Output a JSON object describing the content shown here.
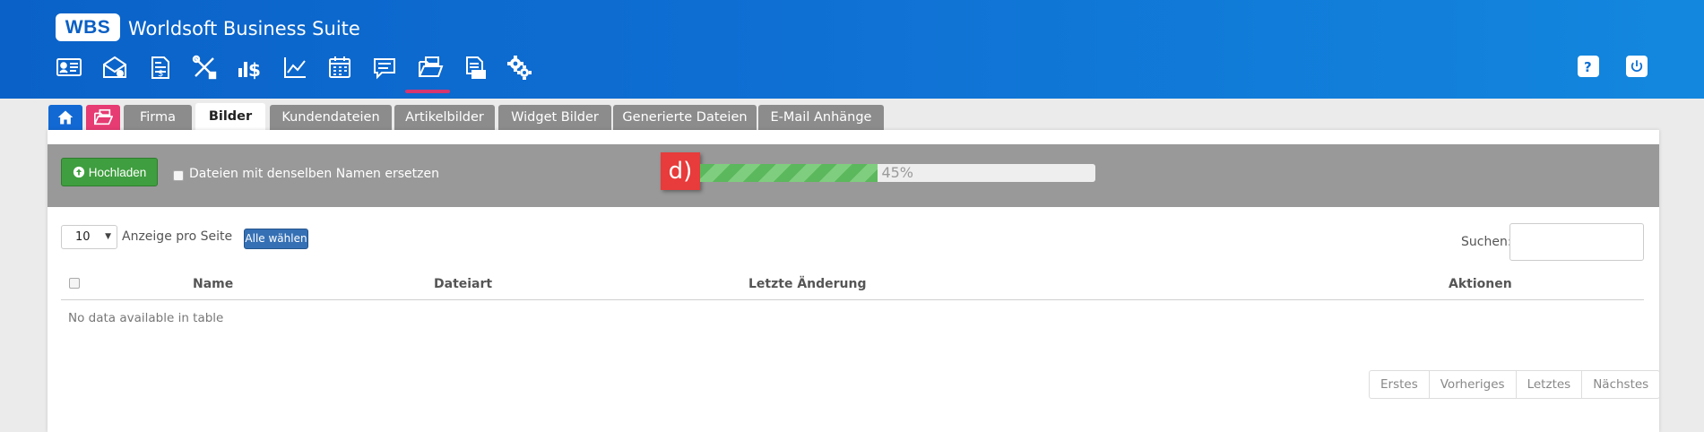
{
  "app": {
    "logo": "WBS",
    "title": "Worldsoft Business Suite"
  },
  "nav_icons": [
    "contact-card-icon",
    "mail-settings-icon",
    "invoice-icon",
    "tools-icon",
    "finance-icon",
    "statistics-icon",
    "calendar-icon",
    "comments-icon",
    "file-manager-icon",
    "documents-icon",
    "settings-icon"
  ],
  "header_right": [
    "help-icon",
    "power-icon"
  ],
  "tabs": [
    {
      "label": "Firma",
      "active": false
    },
    {
      "label": "Bilder",
      "active": true
    },
    {
      "label": "Kundendateien",
      "active": false
    },
    {
      "label": "Artikelbilder",
      "active": false
    },
    {
      "label": "Widget Bilder",
      "active": false
    },
    {
      "label": "Generierte Dateien",
      "active": false
    },
    {
      "label": "E-Mail Anhänge",
      "active": false
    }
  ],
  "upload": {
    "button_label": "Hochladen",
    "replace_label": "Dateien mit denselben Namen ersetzen",
    "replace_checked": false,
    "marker": "d)",
    "progress_percent": 45,
    "progress_text": "45%"
  },
  "table": {
    "page_size": "10",
    "per_page_label": "Anzeige pro Seite",
    "select_all_label": "Alle wählen",
    "search_label": "Suchen:",
    "search_value": "",
    "columns": [
      "Name",
      "Dateiart",
      "Letzte Änderung",
      "Aktionen"
    ],
    "empty_text": "No data available in table",
    "pagination": [
      "Erstes",
      "Vorheriges",
      "Letztes",
      "Nächstes"
    ]
  },
  "colors": {
    "header_blue": "#0f6fd3",
    "active_accent": "#d6356f",
    "upload_green": "#3f9e3f",
    "marker_red": "#e83b3b",
    "tab_gray": "#8c8c8c"
  }
}
